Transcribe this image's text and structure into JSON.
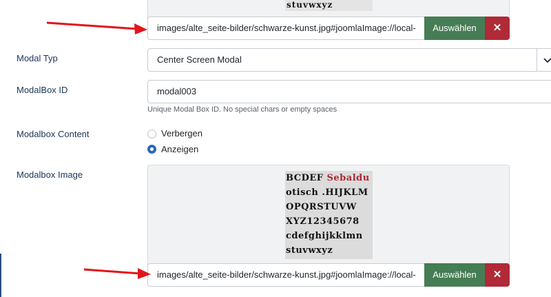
{
  "fields": {
    "image_top": {
      "path_value": "images/alte_seite-bilder/schwarze-kunst.jpg#joomlaImage://local-",
      "select_label": "Auswählen",
      "clear_label": "✕"
    },
    "modal_type": {
      "label": "Modal Typ",
      "selected": "Center Screen Modal",
      "arrow_glyph": "⌄"
    },
    "modalbox_id": {
      "label": "ModalBox ID",
      "value": "modal003",
      "help": "Unique Modal Box ID. No special chars or empty spaces"
    },
    "modalbox_content": {
      "label": "Modalbox Content",
      "options": [
        {
          "label": "Verbergen",
          "checked": false
        },
        {
          "label": "Anzeigen",
          "checked": true
        }
      ]
    },
    "modalbox_image": {
      "label": "Modalbox Image",
      "thumb_lines": [
        "BCDEF Sebaldu",
        "otisch .HIJKLM",
        "OPQRSTUVW",
        "XYZ12345678",
        "cdefghijkklmn",
        "stuvwxyz"
      ],
      "path_value": "images/alte_seite-bilder/schwarze-kunst.jpg#joomlaImage://local-",
      "select_label": "Auswählen",
      "clear_label": "✕"
    }
  },
  "colors": {
    "select_button": "#457d54",
    "clear_button": "#b02a37",
    "annotation_arrow": "#e3141b",
    "label_text": "#1d3557"
  }
}
